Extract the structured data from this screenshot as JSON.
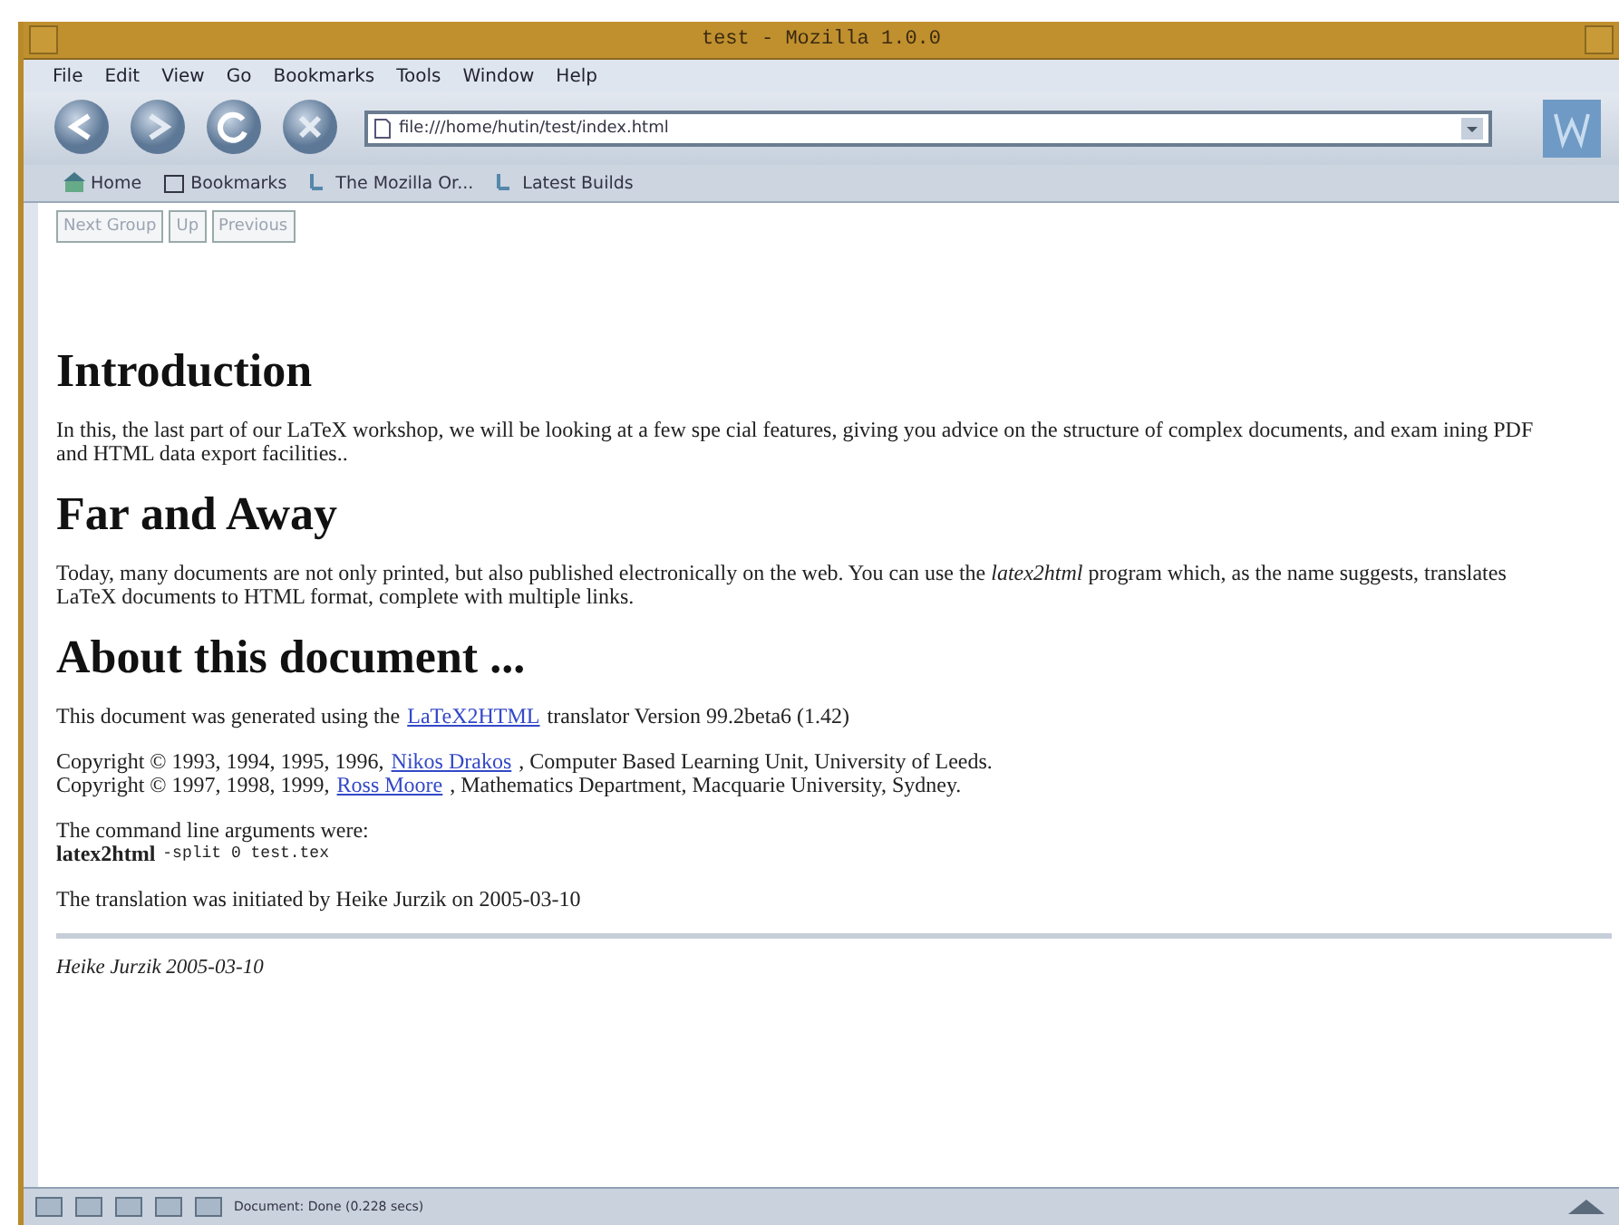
{
  "window": {
    "title": "test - Mozilla 1.0.0"
  },
  "menu": [
    "File",
    "Edit",
    "View",
    "Go",
    "Bookmarks",
    "Tools",
    "Window",
    "Help"
  ],
  "url": "file:///home/hutin/test/index.html",
  "personal_toolbar": [
    {
      "label": "Home",
      "kind": "home"
    },
    {
      "label": "Bookmarks",
      "kind": "bookmarks"
    },
    {
      "label": "The Mozilla Or...",
      "kind": "link"
    },
    {
      "label": "Latest Builds",
      "kind": "link"
    }
  ],
  "nav_buttons": [
    {
      "label": "Next Group",
      "disabled": true
    },
    {
      "label": "Up",
      "disabled": true
    },
    {
      "label": "Previous",
      "disabled": true
    }
  ],
  "blocks": [
    {
      "kind": "heading",
      "text": "Introduction"
    },
    {
      "kind": "paragraph",
      "lines": [
        [
          {
            "kind": "text",
            "text": "In this, the last part of our LaTeX workshop, we will be looking at a few spe cial features, giving you advice on the structure of complex documents, and exam ining PDF and HTML data export facilities.."
          }
        ]
      ]
    },
    {
      "kind": "heading",
      "text": "Far and Away"
    },
    {
      "kind": "paragraph",
      "lines": [
        [
          {
            "kind": "text",
            "text": "Today, many documents are not only printed, but also published electronically on the web. You can use the *latex2html* program which, as the name suggests, translates LaTeX documents to HTML format, complete with multiple links."
          }
        ]
      ]
    },
    {
      "kind": "heading",
      "text": "About this document ..."
    },
    {
      "kind": "paragraph",
      "lines": [
        [
          {
            "kind": "text",
            "text": "This document was generated using the"
          },
          {
            "kind": "link",
            "text": "LaTeX2HTML"
          },
          {
            "kind": "text",
            "text": "translator Version 99.2beta6 (1.42)"
          }
        ]
      ]
    },
    {
      "kind": "paragraph",
      "lines": [
        [
          {
            "kind": "text",
            "text": "Copyright © 1993, 1994, 1995, 1996,"
          },
          {
            "kind": "link",
            "text": "Nikos Drakos"
          },
          {
            "kind": "text",
            "text": ", Computer Based Learning Unit, University of Leeds."
          }
        ],
        [
          {
            "kind": "text",
            "text": "Copyright © 1997, 1998, 1999,"
          },
          {
            "kind": "link",
            "text": "Ross Moore"
          },
          {
            "kind": "text",
            "text": ", Mathematics Department, Macquarie University, Sydney."
          }
        ]
      ]
    },
    {
      "kind": "paragraph",
      "lines": [
        [
          {
            "kind": "text",
            "text": "The command line arguments were:"
          }
        ],
        [
          {
            "kind": "bold",
            "text": "latex2html"
          },
          {
            "kind": "code",
            "text": "-split 0 test.tex"
          }
        ]
      ]
    },
    {
      "kind": "paragraph",
      "lines": [
        [
          {
            "kind": "text",
            "text": "The translation was initiated by Heike Jurzik on 2005-03-10"
          }
        ]
      ]
    },
    {
      "kind": "rule"
    },
    {
      "kind": "address",
      "text": "Heike Jurzik 2005-03-10"
    }
  ],
  "status": "Document: Done (0.228 secs)"
}
